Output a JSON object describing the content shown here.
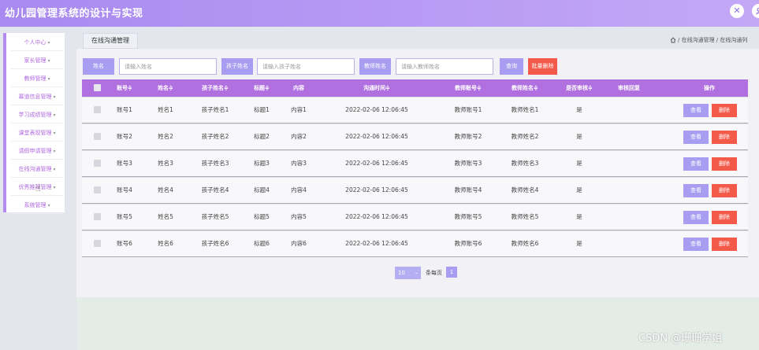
{
  "app": {
    "title": "幼儿园管理系统的设计与实现"
  },
  "header": {
    "close_icon": "✕",
    "user_icon": "user-icon"
  },
  "sidebar": {
    "items": [
      {
        "label": "个人中心"
      },
      {
        "label": "家长管理"
      },
      {
        "label": "教师管理"
      },
      {
        "label": "幕道信息管理"
      },
      {
        "label": "学习成绩管理"
      },
      {
        "label": "课堂表现管理"
      },
      {
        "label": "请假申请管理"
      },
      {
        "label": "在线沟通管理"
      },
      {
        "label": "优秀推荐管理"
      },
      {
        "label": "系统管理"
      }
    ]
  },
  "tab": {
    "label": "在线沟通管理"
  },
  "breadcrumb": {
    "text": "/ 在线沟通管理 / 在线沟通列"
  },
  "filters": {
    "name_label": "姓名",
    "name_placeholder": "请输入姓名",
    "child_label": "孩子姓名",
    "child_placeholder": "请输入孩子姓名",
    "teacher_label": "教师姓名",
    "teacher_placeholder": "请输入教师姓名",
    "search_label": "查询",
    "batch_delete_label": "批量删除"
  },
  "table": {
    "columns": [
      "账号≑",
      "姓名≑",
      "孩子姓名≑",
      "标题≑",
      "内容",
      "沟通时间≑",
      "教师账号≑",
      "教师姓名≑",
      "是否审核≑",
      "审核回复",
      "操作"
    ],
    "rows": [
      {
        "account": "账号1",
        "name": "姓名1",
        "child": "孩子姓名1",
        "title": "标题1",
        "content": "内容1",
        "time": "2022-02-06 12:06:45",
        "teacher_account": "教师账号1",
        "teacher_name": "教师姓名1",
        "reviewed": "是",
        "view": "查看",
        "delete": "删除"
      },
      {
        "account": "账号2",
        "name": "姓名2",
        "child": "孩子姓名2",
        "title": "标题2",
        "content": "内容2",
        "time": "2022-02-06 12:06:45",
        "teacher_account": "教师账号2",
        "teacher_name": "教师姓名2",
        "reviewed": "是",
        "view": "查看",
        "delete": "删除"
      },
      {
        "account": "账号3",
        "name": "姓名3",
        "child": "孩子姓名3",
        "title": "标题3",
        "content": "内容3",
        "time": "2022-02-06 12:06:45",
        "teacher_account": "教师账号3",
        "teacher_name": "教师姓名3",
        "reviewed": "是",
        "view": "查看",
        "delete": "删除"
      },
      {
        "account": "账号4",
        "name": "姓名4",
        "child": "孩子姓名4",
        "title": "标题4",
        "content": "内容4",
        "time": "2022-02-06 12:06:45",
        "teacher_account": "教师账号4",
        "teacher_name": "教师姓名4",
        "reviewed": "是",
        "view": "查看",
        "delete": "删除"
      },
      {
        "account": "账号5",
        "name": "姓名5",
        "child": "孩子姓名5",
        "title": "标题5",
        "content": "内容5",
        "time": "2022-02-06 12:06:45",
        "teacher_account": "教师账号5",
        "teacher_name": "教师姓名5",
        "reviewed": "是",
        "view": "查看",
        "delete": "删除"
      },
      {
        "account": "账号6",
        "name": "姓名6",
        "child": "孩子姓名6",
        "title": "标题6",
        "content": "内容6",
        "time": "2022-02-06 12:06:45",
        "teacher_account": "教师账号6",
        "teacher_name": "教师姓名6",
        "reviewed": "是",
        "view": "查看",
        "delete": "删除"
      }
    ]
  },
  "pager": {
    "page_size": "10",
    "per_page_label": "条每页",
    "current_page": "1"
  },
  "watermark": {
    "text": "CSDN @珊珊学姐"
  },
  "colors": {
    "header": "#b39cf4",
    "accent": "#a89df0",
    "table_head": "#b070e0",
    "danger": "#f45a4a"
  }
}
